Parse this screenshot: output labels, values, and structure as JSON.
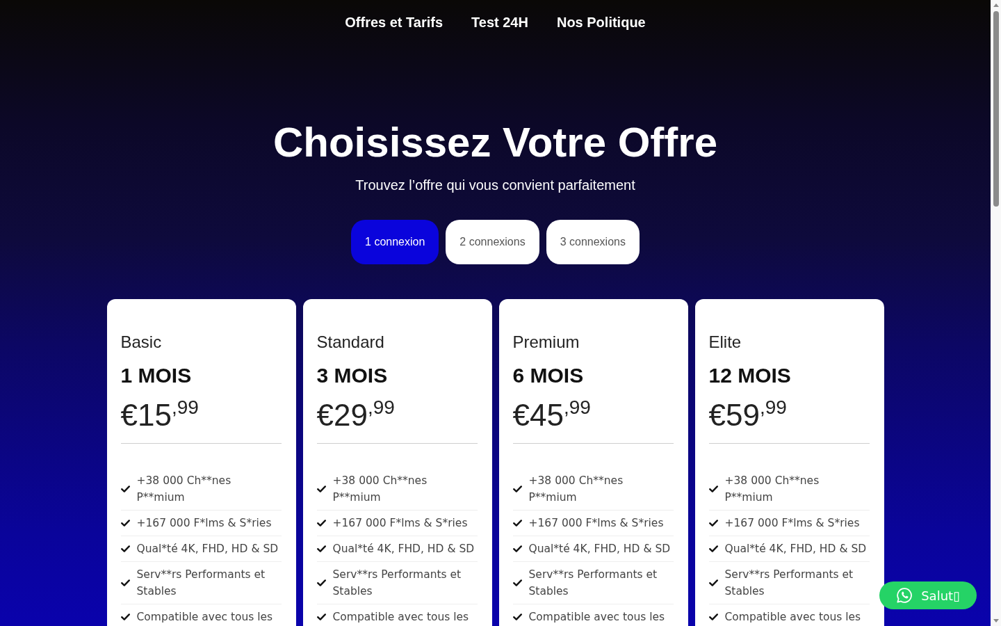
{
  "nav": {
    "links": [
      "Offres et Tarifs",
      "Test 24H",
      "Nos Politique"
    ]
  },
  "hero": {
    "title": "Choisissez Votre Offre",
    "subtitle": "Trouvez l’offre qui vous convient parfaitement"
  },
  "connection_options": [
    {
      "label": "1 connexion",
      "selected": true
    },
    {
      "label": "2 connexions",
      "selected": false
    },
    {
      "label": "3 connexions",
      "selected": false
    }
  ],
  "plans": [
    {
      "name": "Basic",
      "duration": "1 MOIS",
      "price": "€15$^{,99}$",
      "features": [
        "+38 000 Ch**nes P**mium",
        "+167 000 F*lms & S*ries",
        "Qual*té 4K, FHD, HD & SD",
        "Serv**rs Performants et Stables",
        "Compatible avec tous les"
      ]
    },
    {
      "name": "Standard",
      "duration": "3 MOIS",
      "price": "€29$^{,99}$",
      "features": [
        "+38 000 Ch**nes P**mium",
        "+167 000 F*lms & S*ries",
        "Qual*té 4K, FHD, HD & SD",
        "Serv**rs Performants et Stables",
        "Compatible avec tous les"
      ]
    },
    {
      "name": "Premium",
      "duration": "6 MOIS",
      "price": "€45$^{,99}$",
      "features": [
        "+38 000 Ch**nes P**mium",
        "+167 000 F*lms & S*ries",
        "Qual*té 4K, FHD, HD & SD",
        "Serv**rs Performants et Stables",
        "Compatible avec tous les"
      ]
    },
    {
      "name": "Elite",
      "duration": "12 MOIS",
      "price": "€59$^{,99}$",
      "features": [
        "+38 000 Ch**nes P**mium",
        "+167 000 F*lms & S*ries",
        "Qual*té 4K, FHD, HD & SD",
        "Serv**rs Performants et Stables",
        "Compatible avec tous les"
      ]
    }
  ],
  "chat_button": {
    "label": "Salut▯"
  }
}
